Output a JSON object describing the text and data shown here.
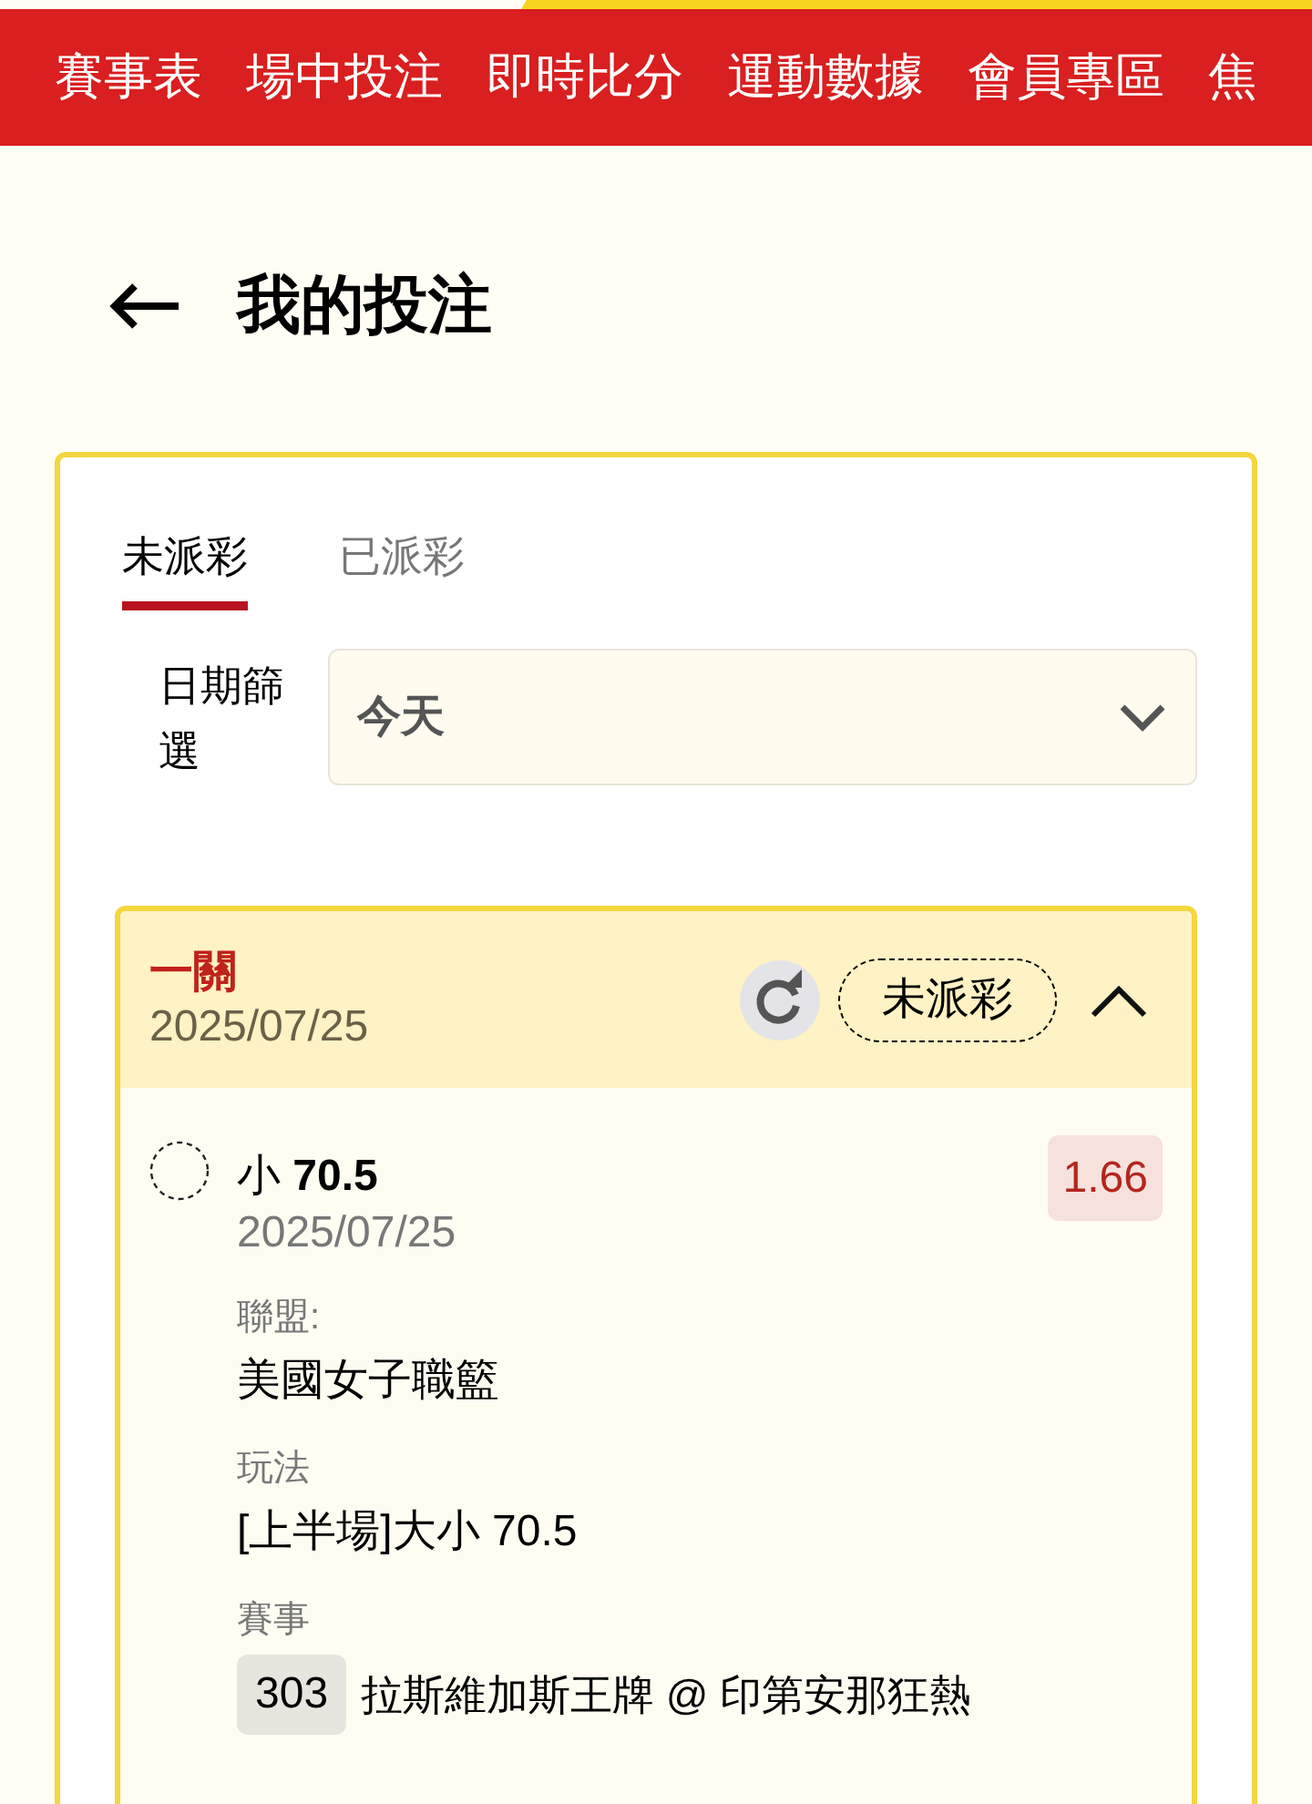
{
  "top_nav": {
    "items": [
      {
        "label": "賽事表"
      },
      {
        "label": "場中投注"
      },
      {
        "label": "即時比分"
      },
      {
        "label": "運動數據"
      },
      {
        "label": "會員專區"
      },
      {
        "label": "焦"
      }
    ]
  },
  "header": {
    "title": "我的投注"
  },
  "tabs": [
    {
      "label": "未派彩",
      "selected": true
    },
    {
      "label": "已派彩",
      "selected": false
    }
  ],
  "date_filter": {
    "label": "日期篩選",
    "value": "今天"
  },
  "bets": [
    {
      "type": "一關",
      "date": "2025/07/25",
      "status": "未派彩",
      "expanded": true,
      "selections": [
        {
          "selection": "小 **70.5**",
          "date": "2025/07/25",
          "odds": "1.66",
          "fields": [
            {
              "kind": "text",
              "label": "聯盟:",
              "value": "美國女子職籃"
            },
            {
              "kind": "text",
              "label": "玩法",
              "value": "[上半場]大小 70.5"
            },
            {
              "kind": "match",
              "label": "賽事",
              "match_no": "303",
              "value": "拉斯維加斯王牌 @ 印第安那狂熱"
            }
          ]
        }
      ]
    }
  ]
}
